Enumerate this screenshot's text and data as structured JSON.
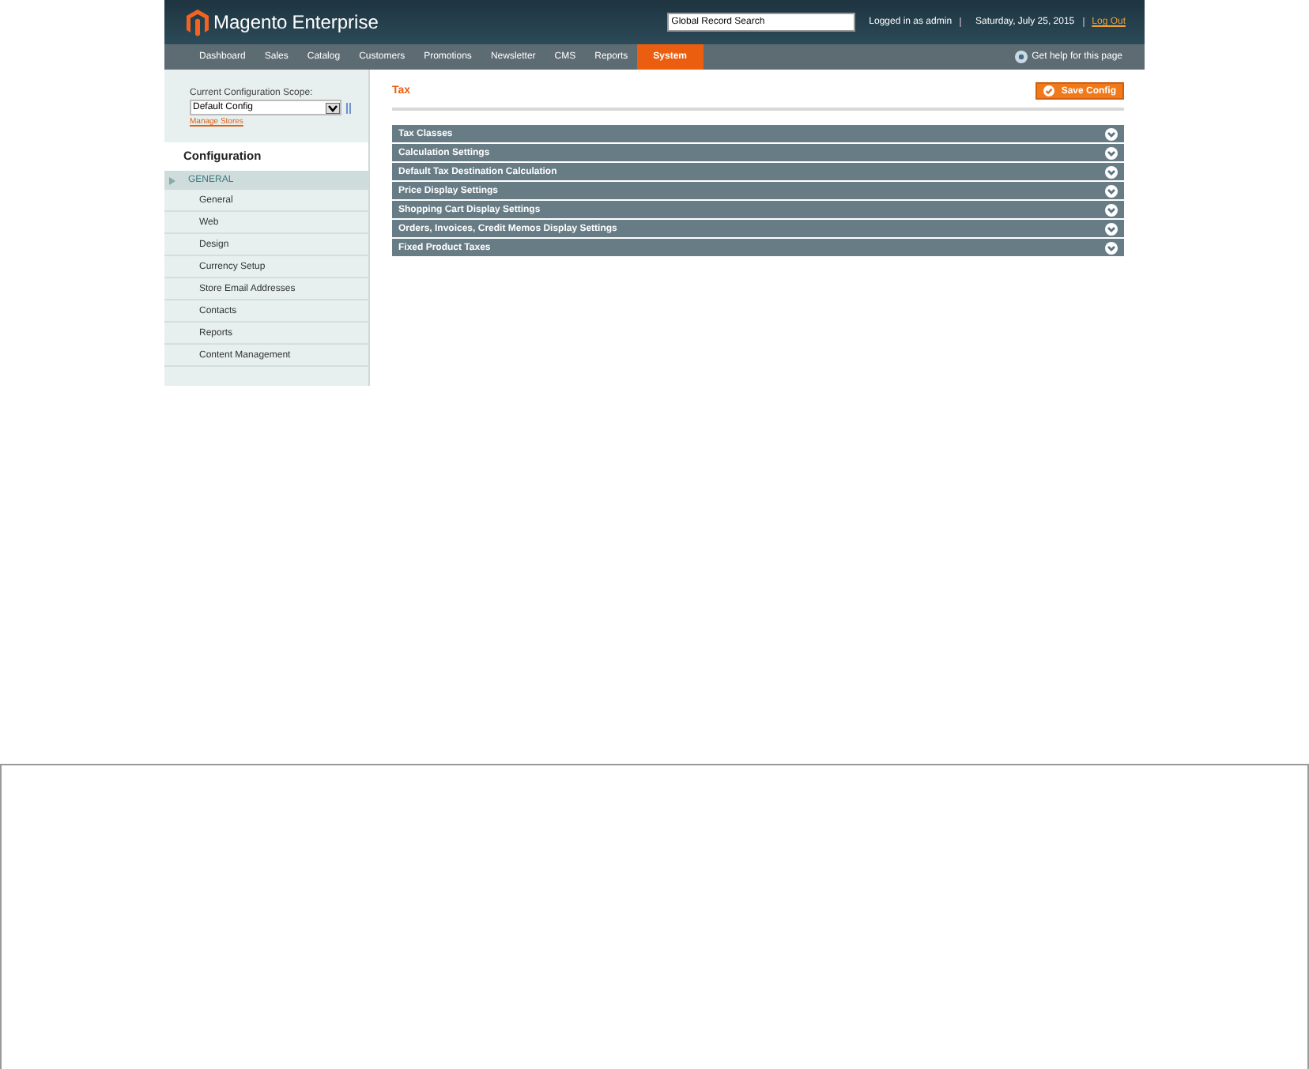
{
  "header": {
    "logo": "Magento",
    "logo_sub": "Enterprise",
    "search": {
      "value": "Global Record Search"
    },
    "user": "Logged in as admin",
    "date": "Saturday, July 25, 2015",
    "logout": "Log Out"
  },
  "nav": [
    {
      "label": "Dashboard",
      "selected": false
    },
    {
      "label": "Sales",
      "selected": false
    },
    {
      "label": "Catalog",
      "selected": false
    },
    {
      "label": "Customers",
      "selected": false
    },
    {
      "label": "Promotions",
      "selected": false
    },
    {
      "label": "Newsletter",
      "selected": false
    },
    {
      "label": "CMS",
      "selected": false
    },
    {
      "label": "Reports",
      "selected": false
    },
    {
      "label": "System",
      "selected": true
    }
  ],
  "help": "Get help for this page",
  "sidebar": {
    "scope_label": "Current Configuration Scope:",
    "scope": "Default Config",
    "manage": "Manage Stores",
    "title": "Configuration",
    "group": "GENERAL",
    "items": [
      {
        "label": "General",
        "selected": false
      },
      {
        "label": "Web",
        "selected": false
      },
      {
        "label": "Design",
        "selected": false
      },
      {
        "label": "Currency Setup",
        "selected": false
      },
      {
        "label": "Store Email Addresses",
        "selected": false
      },
      {
        "label": "Contacts",
        "selected": false
      },
      {
        "label": "Reports",
        "selected": false
      },
      {
        "label": "Content Management",
        "selected": false
      }
    ]
  },
  "page_title": "Tax",
  "save_button": "Save Config",
  "sections": [
    {
      "label": "Tax Classes",
      "expanded": false
    },
    {
      "label": "Calculation Settings",
      "expanded": false
    },
    {
      "label": "Default Tax Destination Calculation",
      "expanded": false
    },
    {
      "label": "Price Display Settings",
      "expanded": false
    },
    {
      "label": "Shopping Cart Display Settings",
      "expanded": false
    },
    {
      "label": "Orders, Invoices, Credit Memos Display Settings",
      "expanded": false
    },
    {
      "label": "Fixed Product Taxes",
      "expanded": false
    }
  ]
}
